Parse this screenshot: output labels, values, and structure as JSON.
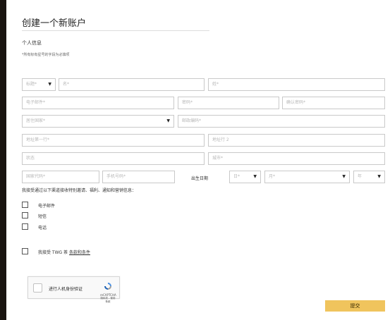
{
  "page": {
    "title": "创建一个新账户",
    "section": "个人信息",
    "required_note": "*所有标有星号的字段为必填项"
  },
  "form": {
    "salutation": "标题*",
    "first_name": "名*",
    "last_name": "姓*",
    "email": "电子邮件*",
    "password": "密码*",
    "confirm_password": "确认密码*",
    "country": "居住国家*",
    "postcode": "邮政编码*",
    "address1": "地址第一行*",
    "address2": "地址行 2",
    "state": "状态",
    "city": "城市*",
    "country_code": "国家代码*",
    "phone": "手机号码*",
    "dob_label": "出生日期",
    "day": "日*",
    "month": "月*",
    "year": "年"
  },
  "consent": {
    "intro": "我接受通过以下渠道接收特别邀请、福利、通知和营销信息：",
    "email": "电子邮件",
    "sms": "短信",
    "phone": "电话",
    "terms_prefix": "我接受 TWG 茶",
    "terms_link": "条款和条件"
  },
  "captcha": {
    "label": "进行人机身份验证",
    "brand": "reCAPTCHA",
    "terms": "隐私权 - 使用条款"
  },
  "submit": "提交",
  "colors": {
    "accent": "#f0c45d",
    "background": "#1a1510",
    "border": "#c9c9c9"
  }
}
